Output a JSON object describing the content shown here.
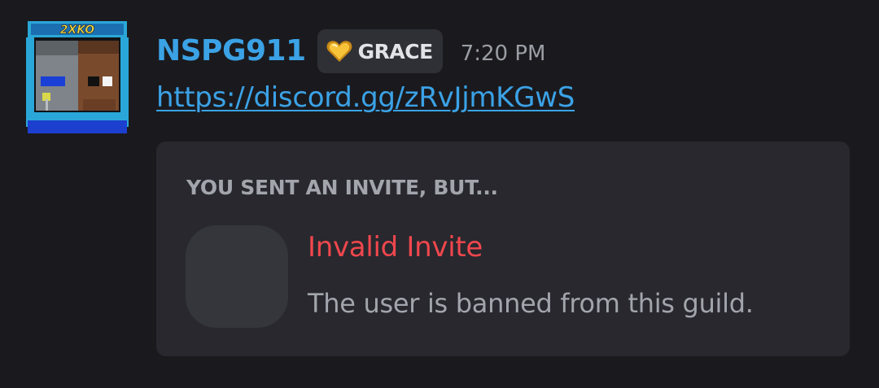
{
  "message": {
    "author": {
      "username": "NSPG911",
      "avatar_icon": "arcade-cabinet-avatar-icon",
      "avatar_logo": "2XKO",
      "color": "#3ba2e6"
    },
    "guild_tag": {
      "icon": "golden-heart-icon",
      "label": "GRACE"
    },
    "timestamp": "7:20 PM",
    "link": "https://discord.gg/zRvJjmKGwS"
  },
  "invite_embed": {
    "header": "YOU SENT AN INVITE, BUT...",
    "title": "Invalid Invite",
    "description": "The user is banned from this guild.",
    "title_color": "#f0474d"
  }
}
